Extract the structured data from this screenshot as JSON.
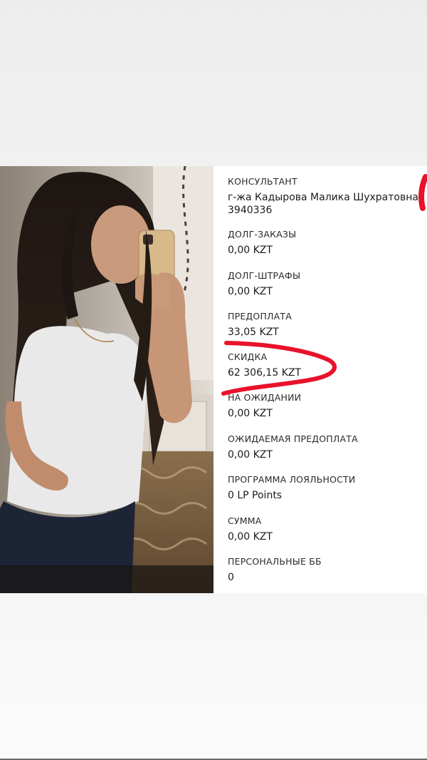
{
  "account": {
    "fields": [
      {
        "label": "КОНСУЛЬТАНТ",
        "value": "г-жа Кадырова Малика Шухратовна",
        "value2": "3940336"
      },
      {
        "label": "ДОЛГ-ЗАКАЗЫ",
        "value": "0,00 KZT"
      },
      {
        "label": "ДОЛГ-ШТРАФЫ",
        "value": "0,00 KZT"
      },
      {
        "label": "ПРЕДОПЛАТА",
        "value": "33,05 KZT"
      },
      {
        "label": "СКИДКА",
        "value": "62 306,15 KZT"
      },
      {
        "label": "НА ОЖИДАНИИ",
        "value": "0,00 KZT"
      },
      {
        "label": "ОЖИДАЕМАЯ ПРЕДОПЛАТА",
        "value": "0,00 KZT"
      },
      {
        "label": "ПРОГРАММА ЛОЯЛЬНОСТИ",
        "value": "0 LP Points"
      },
      {
        "label": "СУММА",
        "value": "0,00 KZT"
      },
      {
        "label": "ПЕРСОНАЛЬНЫЕ ББ",
        "value": "0"
      }
    ]
  },
  "colors": {
    "annotation": "#e8122a",
    "text": "#1b1b1b"
  }
}
